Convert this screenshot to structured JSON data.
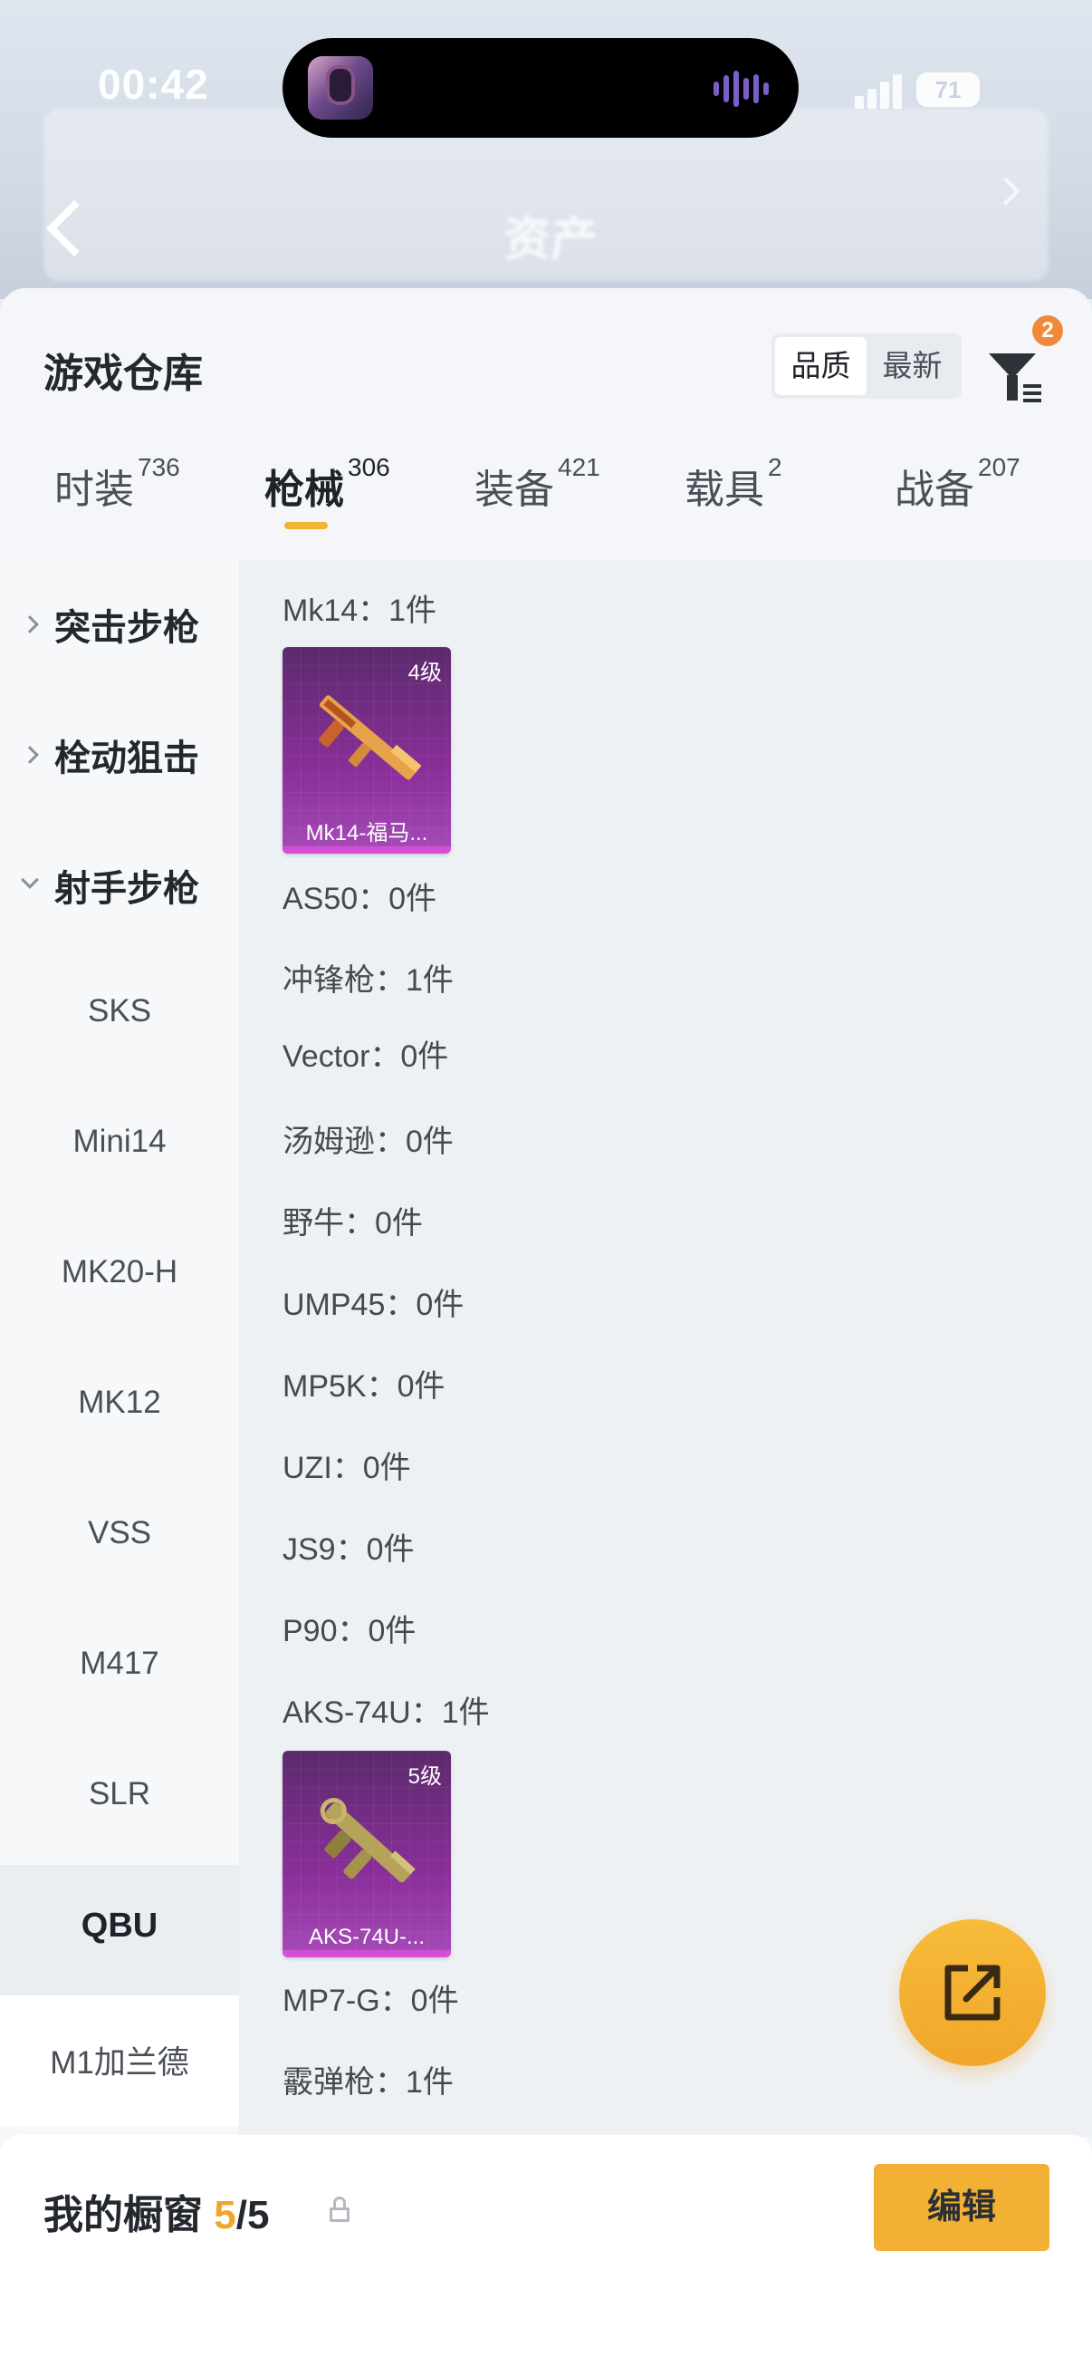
{
  "status_bar": {
    "time": "00:42",
    "battery": "71"
  },
  "header_blur": {
    "title": "资产"
  },
  "sheet": {
    "title": "游戏仓库",
    "sort": {
      "options": [
        "品质",
        "最新"
      ],
      "selected": "品质"
    },
    "filter_badge": "2"
  },
  "tabs": [
    {
      "label": "时装",
      "count": "736"
    },
    {
      "label": "枪械",
      "count": "306",
      "active": true
    },
    {
      "label": "装备",
      "count": "421"
    },
    {
      "label": "载具",
      "count": "2"
    },
    {
      "label": "战备",
      "count": "207"
    }
  ],
  "categories": {
    "groups": [
      "突击步枪",
      "栓动狙击",
      "射手步枪"
    ],
    "subitems": [
      "SKS",
      "Mini14",
      "MK20-H",
      "MK12",
      "VSS",
      "M417",
      "SLR",
      "QBU",
      "M1加兰德"
    ],
    "active": "QBU"
  },
  "list": {
    "rows": [
      "Mk14：1件",
      "AS50：0件",
      "冲锋枪：1件",
      "Vector：0件",
      "汤姆逊：0件",
      "野牛：0件",
      "UMP45：0件",
      "MP5K：0件",
      "UZI：0件",
      "JS9：0件",
      "P90：0件",
      "AKS-74U：1件",
      "MP7-G：0件",
      "霰弹枪：1件"
    ],
    "cards": [
      {
        "level": "4级",
        "name": "Mk14-福马..."
      },
      {
        "level": "5级",
        "name": "AKS-74U-..."
      }
    ]
  },
  "bottom": {
    "label": "我的橱窗",
    "current": "5",
    "total": "/5",
    "edit": "编辑"
  },
  "colors": {
    "accent": "#f2b135",
    "card": "#8a2f9a",
    "badge": "#f08a3a"
  }
}
